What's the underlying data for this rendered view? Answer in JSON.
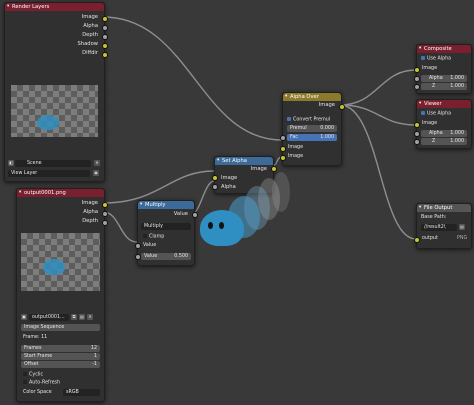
{
  "render_layers": {
    "title": "Render Layers",
    "outputs": [
      "Image",
      "Alpha",
      "Depth",
      "Shadow",
      "Diffdir"
    ],
    "scene": "Scene",
    "layer": "View Layer"
  },
  "image_node": {
    "title": "output0001.png",
    "outputs": [
      "Image",
      "Alpha",
      "Depth"
    ],
    "file": "output0001...",
    "source": "Image Sequence",
    "frame_label": "Frame: 11",
    "frames_label": "Frames",
    "frames_value": "12",
    "start_label": "Start Frame",
    "start_value": "1",
    "offset_label": "Offset",
    "offset_value": "-1",
    "cyclic": "Cyclic",
    "auto_refresh": "Auto-Refresh",
    "color_space_label": "Color Space",
    "color_space_value": "sRGB"
  },
  "multiply": {
    "title": "Multiply",
    "output": "Value",
    "op": "Multiply",
    "clamp": "Clamp",
    "input_label": "Value",
    "value_label": "Value",
    "value": "0.500"
  },
  "set_alpha": {
    "title": "Set Alpha",
    "output": "Image",
    "inputs": [
      "Image",
      "Alpha"
    ]
  },
  "alpha_over": {
    "title": "Alpha Over",
    "output": "Image",
    "convert": "Convert Premul",
    "premul_label": "Premul",
    "premul_value": "0.000",
    "fac_label": "Fac",
    "fac_value": "1.000",
    "inputs": [
      "Image",
      "Image"
    ]
  },
  "composite": {
    "title": "Composite",
    "use_alpha": "Use Alpha",
    "image": "Image",
    "alpha_label": "Alpha",
    "alpha_value": "1.000",
    "z_label": "Z",
    "z_value": "1.000"
  },
  "viewer": {
    "title": "Viewer",
    "use_alpha": "Use Alpha",
    "image": "Image",
    "alpha_label": "Alpha",
    "alpha_value": "1.000",
    "z_label": "Z",
    "z_value": "1.000"
  },
  "file_output": {
    "title": "File Output",
    "base_path": "Base Path:",
    "path_value": "//result2\\",
    "input": "output",
    "format": "PNG"
  },
  "colors": {
    "socket_color": "#c7c729",
    "socket_value": "#a1a1a1",
    "header_input": "#7a1f2e",
    "header_converter": "#3c6a99",
    "header_output": "#8c7a2c"
  }
}
